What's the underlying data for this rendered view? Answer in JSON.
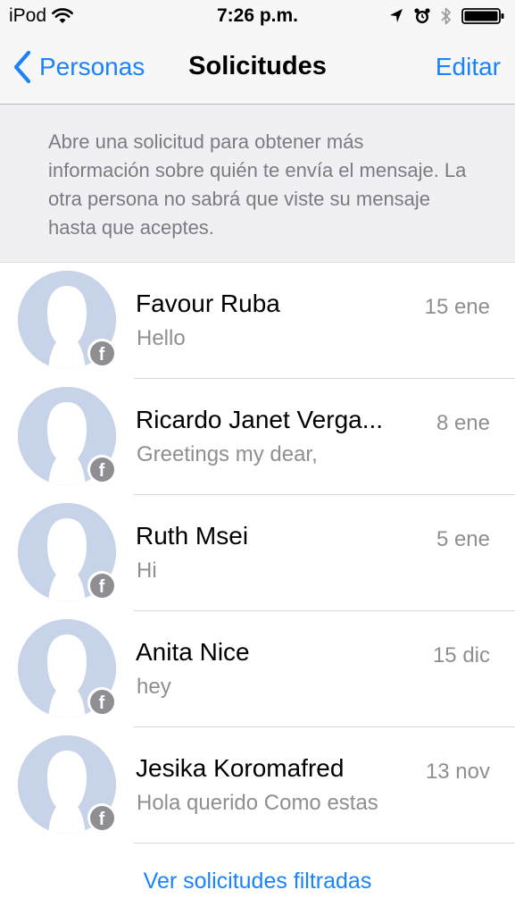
{
  "status_bar": {
    "carrier": "iPod",
    "time": "7:26 p.m."
  },
  "nav": {
    "back_label": "Personas",
    "title": "Solicitudes",
    "edit_label": "Editar"
  },
  "info": {
    "text": "Abre una solicitud para obtener más información sobre quién te envía el mensaje. La otra persona no sabrá que viste su mensaje hasta que aceptes."
  },
  "requests": [
    {
      "name": "Favour Ruba",
      "date": "15 ene",
      "preview": "Hello"
    },
    {
      "name": "Ricardo Janet Verga...",
      "date": "8 ene",
      "preview": "Greetings my dear,"
    },
    {
      "name": "Ruth Msei",
      "date": "5 ene",
      "preview": "Hi"
    },
    {
      "name": "Anita Nice",
      "date": "15 dic",
      "preview": "hey"
    },
    {
      "name": "Jesika Koromafred",
      "date": "13 nov",
      "preview": "Hola querido Como estas"
    }
  ],
  "footer": {
    "filtered_link": "Ver solicitudes filtradas"
  },
  "icons": {
    "wifi": "wifi-icon",
    "location": "location-arrow-icon",
    "alarm": "alarm-clock-icon",
    "bluetooth": "bluetooth-icon",
    "battery": "battery-icon",
    "back": "chevron-left-icon",
    "badge": "facebook-badge-icon"
  },
  "colors": {
    "accent": "#1a82fb",
    "secondary_text": "#8e8e93",
    "banner_bg": "#efeff4",
    "avatar_bg": "#c7d3e8"
  }
}
